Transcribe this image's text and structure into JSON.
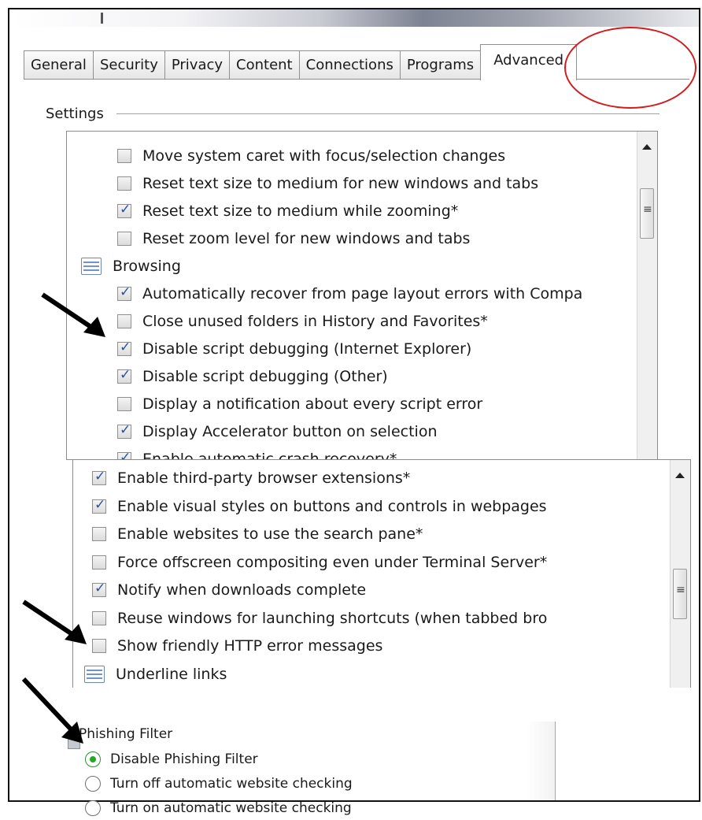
{
  "tabs": [
    "General",
    "Security",
    "Privacy",
    "Content",
    "Connections",
    "Programs",
    "Advanced"
  ],
  "active_tab": "Advanced",
  "settings_label": "Settings",
  "list1": [
    {
      "type": "checkbox",
      "checked": false,
      "label": "Move system caret with focus/selection changes"
    },
    {
      "type": "checkbox",
      "checked": false,
      "label": "Reset text size to medium for new windows and tabs"
    },
    {
      "type": "checkbox",
      "checked": true,
      "label": "Reset text size to medium while zooming*"
    },
    {
      "type": "checkbox",
      "checked": false,
      "label": "Reset zoom level for new windows and tabs"
    },
    {
      "type": "category",
      "label": "Browsing"
    },
    {
      "type": "checkbox",
      "checked": true,
      "label": "Automatically recover from page layout errors with Compa"
    },
    {
      "type": "checkbox",
      "checked": false,
      "label": "Close unused folders in History and Favorites*"
    },
    {
      "type": "checkbox",
      "checked": true,
      "label": "Disable script debugging (Internet Explorer)"
    },
    {
      "type": "checkbox",
      "checked": true,
      "label": "Disable script debugging (Other)"
    },
    {
      "type": "checkbox",
      "checked": false,
      "label": "Display a notification about every script error"
    },
    {
      "type": "checkbox",
      "checked": true,
      "label": "Display Accelerator button on selection"
    },
    {
      "type": "checkbox",
      "checked": true,
      "label": "Enable automatic crash recovery*"
    }
  ],
  "list2": [
    {
      "type": "checkbox",
      "checked": true,
      "label": "Enable third-party browser extensions*"
    },
    {
      "type": "checkbox",
      "checked": true,
      "label": "Enable visual styles on buttons and controls in webpages"
    },
    {
      "type": "checkbox",
      "checked": false,
      "label": "Enable websites to use the search pane*"
    },
    {
      "type": "checkbox",
      "checked": false,
      "label": "Force offscreen compositing even under Terminal Server*"
    },
    {
      "type": "checkbox",
      "checked": true,
      "label": "Notify when downloads complete"
    },
    {
      "type": "checkbox",
      "checked": false,
      "label": "Reuse windows for launching shortcuts (when tabbed bro"
    },
    {
      "type": "checkbox",
      "checked": false,
      "label": "Show friendly HTTP error messages"
    },
    {
      "type": "category",
      "label": "Underline links"
    }
  ],
  "phishing": {
    "heading": "Phishing Filter",
    "options": [
      {
        "label": "Disable Phishing Filter",
        "selected": true
      },
      {
        "label": "Turn off automatic website checking",
        "selected": false
      },
      {
        "label": "Turn on automatic website checking",
        "selected": false
      }
    ]
  },
  "colors": {
    "highlight_circle": "#d21d1d",
    "check": "#2a4fa6",
    "radio_selected": "#25a825"
  }
}
